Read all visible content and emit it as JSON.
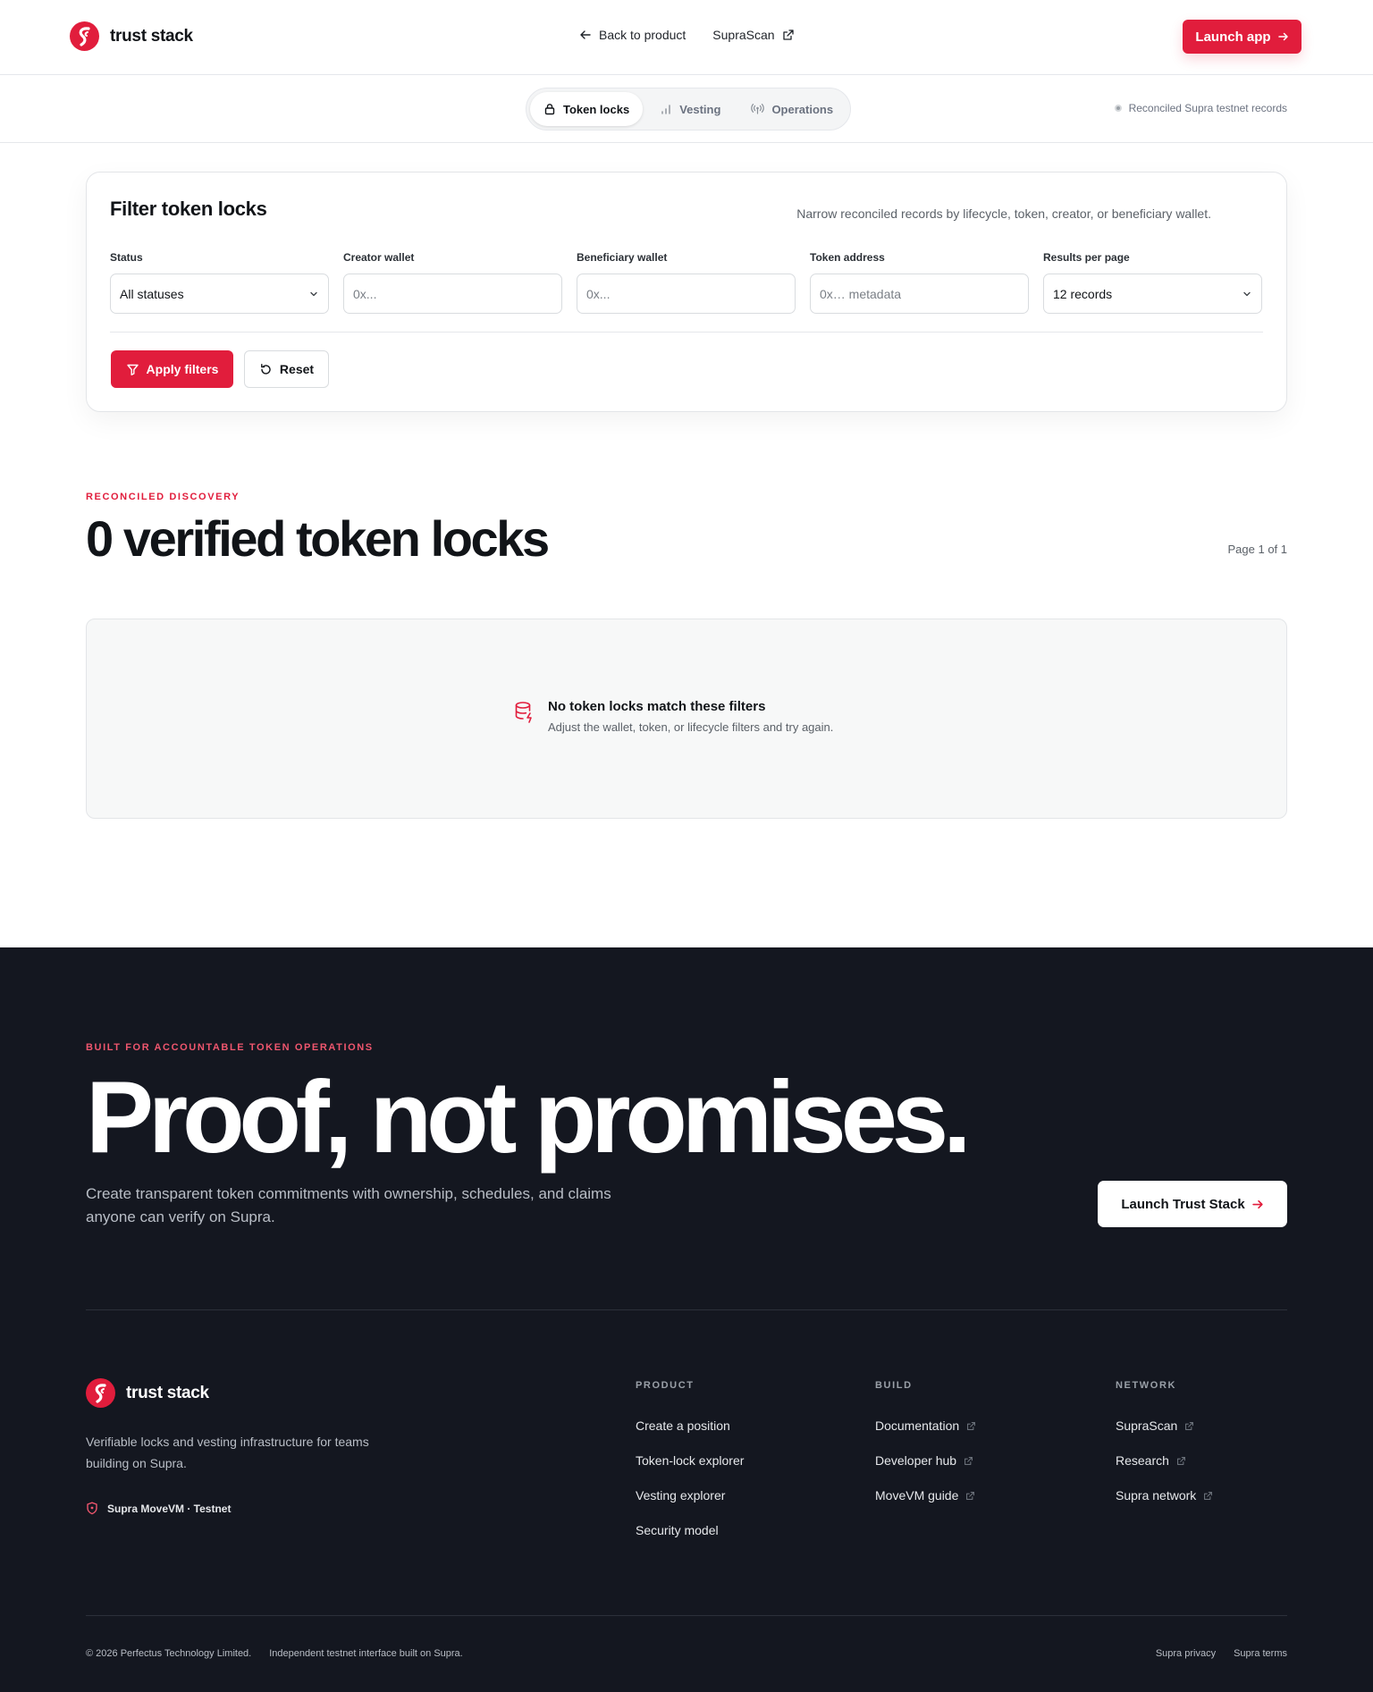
{
  "brand": {
    "name": "trust stack"
  },
  "header": {
    "back_label": "Back to product",
    "suprascan_label": "SupraScan",
    "launch_label": "Launch app"
  },
  "tabs": [
    {
      "label": "Token locks",
      "icon": "lock-icon",
      "active": true
    },
    {
      "label": "Vesting",
      "icon": "bar-chart-icon",
      "active": false
    },
    {
      "label": "Operations",
      "icon": "radio-signal-icon",
      "active": false
    }
  ],
  "records_note": "Reconciled Supra testnet records",
  "filters": {
    "title": "Filter token locks",
    "description": "Narrow reconciled records by lifecycle, token, creator, or beneficiary wallet.",
    "status": {
      "label": "Status",
      "value": "All statuses"
    },
    "creator": {
      "label": "Creator wallet",
      "placeholder": "0x..."
    },
    "beneficiary": {
      "label": "Beneficiary wallet",
      "placeholder": "0x..."
    },
    "token": {
      "label": "Token address",
      "placeholder": "0x… metadata"
    },
    "per_page": {
      "label": "Results per page",
      "value": "12 records"
    },
    "apply_label": "Apply filters",
    "reset_label": "Reset"
  },
  "discovery": {
    "eyebrow": "Reconciled discovery",
    "title": "0 verified token locks",
    "page_indicator": "Page 1 of 1",
    "empty_title": "No token locks match these filters",
    "empty_sub": "Adjust the wallet, token, or lifecycle filters and try again."
  },
  "footer": {
    "eyebrow": "Built for accountable token operations",
    "hero_title": "Proof, not promises.",
    "hero_sub": "Create transparent token commitments with ownership, schedules, and claims anyone can verify on Supra.",
    "hero_button": "Launch Trust Stack",
    "description": "Verifiable locks and vesting infrastructure for teams building on Supra.",
    "network_badge": "Supra MoveVM · Testnet",
    "columns": [
      {
        "heading": "Product",
        "links": [
          {
            "label": "Create a position",
            "external": false
          },
          {
            "label": "Token-lock explorer",
            "external": false
          },
          {
            "label": "Vesting explorer",
            "external": false
          },
          {
            "label": "Security model",
            "external": false
          }
        ]
      },
      {
        "heading": "Build",
        "links": [
          {
            "label": "Documentation",
            "external": true
          },
          {
            "label": "Developer hub",
            "external": true
          },
          {
            "label": "MoveVM guide",
            "external": true
          }
        ]
      },
      {
        "heading": "Network",
        "links": [
          {
            "label": "SupraScan",
            "external": true
          },
          {
            "label": "Research",
            "external": true
          },
          {
            "label": "Supra network",
            "external": true
          }
        ]
      }
    ],
    "copyright": "© 2026 Perfectus Technology Limited.",
    "tagline": "Independent testnet interface built on Supra.",
    "privacy": "Supra privacy",
    "terms": "Supra terms"
  },
  "colors": {
    "accent": "#e11d3c",
    "footer_bg": "#141720"
  }
}
